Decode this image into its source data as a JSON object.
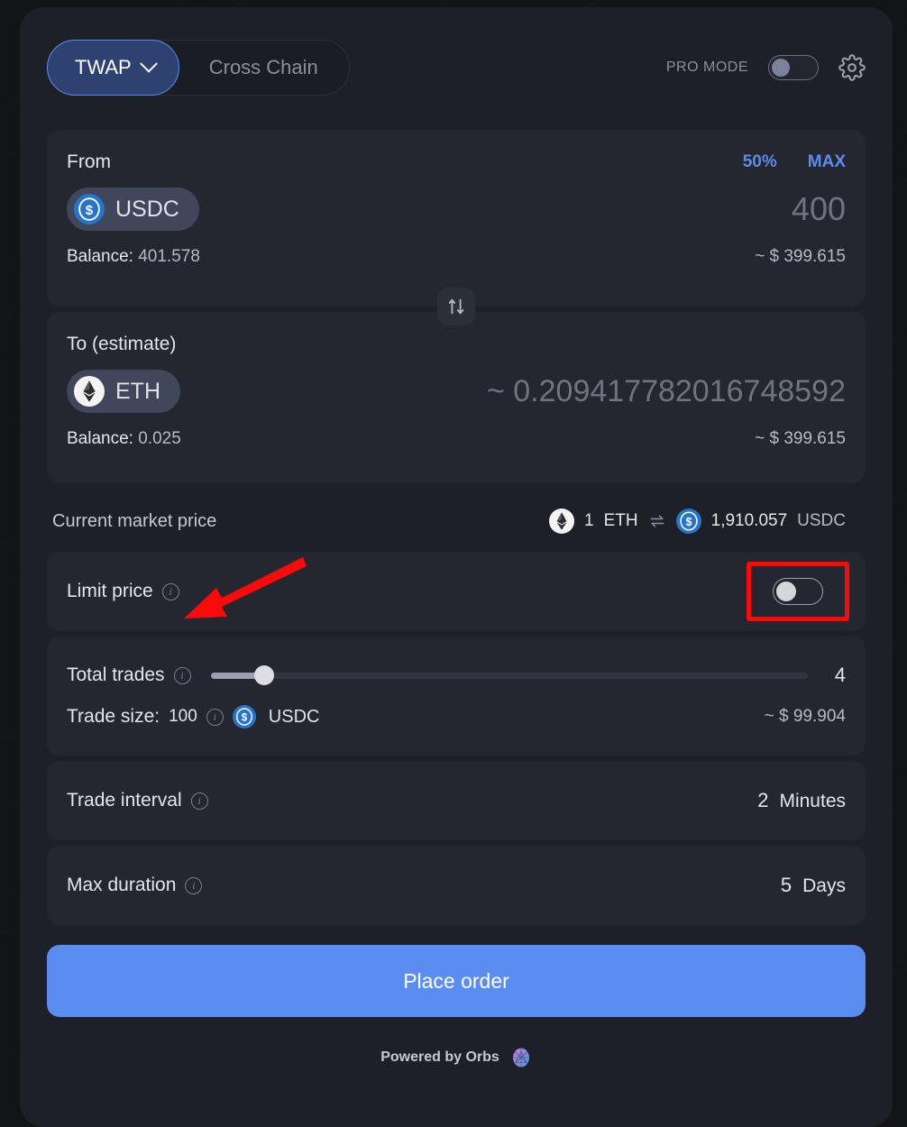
{
  "header": {
    "mode_selected": "TWAP",
    "mode_alt": "Cross Chain",
    "pro_mode_label": "PRO MODE",
    "pro_mode_on": false,
    "settings_icon": "gear-icon",
    "chevron_icon": "chevron-down-icon"
  },
  "from": {
    "label": "From",
    "half_label": "50%",
    "max_label": "MAX",
    "token": "USDC",
    "token_icon": "usdc-coin-icon",
    "amount": "400",
    "balance_label": "Balance:",
    "balance_value": "401.578",
    "usd_value": "~ $ 399.615"
  },
  "swap": {
    "icon": "swap-vertical-arrows-icon"
  },
  "to": {
    "label": "To (estimate)",
    "token": "ETH",
    "token_icon": "ethereum-coin-icon",
    "amount": "~ 0.209417782016748592",
    "balance_label": "Balance:",
    "balance_value": "0.025",
    "usd_value": "~ $ 399.615"
  },
  "market_price": {
    "label": "Current market price",
    "base_icon": "ethereum-coin-icon",
    "base_amount": "1",
    "base_symbol": "ETH",
    "swap_icon": "swap-horizontal-arrows-icon",
    "quote_icon": "usdc-coin-icon",
    "quote_amount": "1,910.057",
    "quote_symbol": "USDC"
  },
  "limit_price": {
    "label": "Limit price",
    "info_icon": "info-circle-icon",
    "toggle_on": false,
    "highlighted": true,
    "highlight_color": "#fb0a0a"
  },
  "total_trades": {
    "label": "Total trades",
    "info_icon": "info-circle-icon",
    "value": "4",
    "slider_percent": 9
  },
  "trade_size": {
    "label": "Trade size:",
    "value": "100",
    "info_icon": "info-circle-icon",
    "token_icon": "usdc-coin-icon",
    "token": "USDC",
    "usd_value": "~ $ 99.904"
  },
  "trade_interval": {
    "label": "Trade interval",
    "info_icon": "info-circle-icon",
    "value": "2",
    "unit": "Minutes"
  },
  "max_duration": {
    "label": "Max duration",
    "info_icon": "info-circle-icon",
    "value": "5",
    "unit": "Days"
  },
  "place_order": {
    "label": "Place order"
  },
  "footer": {
    "text": "Powered by Orbs",
    "logo_icon": "orbs-logo-icon"
  },
  "annotation": {
    "arrow_color": "#fb0a0a",
    "arrow_points_to": "limit-price-info-icon"
  },
  "colors": {
    "accent": "#5b8cf0",
    "card_bg": "#1d2027",
    "panel_bg": "#24272f",
    "page_bg": "#121418",
    "annotation_red": "#fb0a0a"
  }
}
